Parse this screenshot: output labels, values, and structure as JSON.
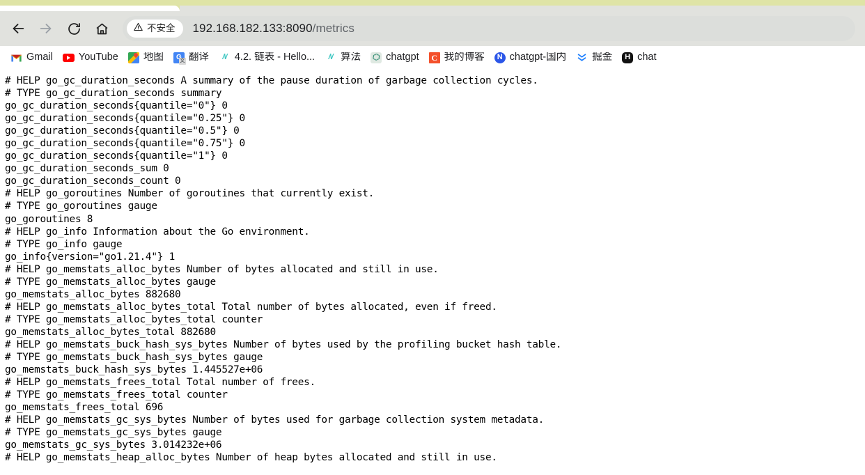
{
  "browser": {
    "tab_strip_color": "#dfe4a6",
    "toolbar_color": "#e1e2de",
    "nav": {
      "back_label": "Back",
      "forward_label": "Forward",
      "reload_label": "Reload",
      "home_label": "Home"
    },
    "omnibox": {
      "security_label": "不安全",
      "url_host": "192.168.182.133:8090",
      "url_path": "/metrics",
      "full_url": "192.168.182.133:8090/metrics"
    },
    "bookmarks": [
      {
        "label": "Gmail",
        "icon": "gmail-icon"
      },
      {
        "label": "YouTube",
        "icon": "youtube-icon"
      },
      {
        "label": "地图",
        "icon": "google-maps-icon"
      },
      {
        "label": "翻译",
        "icon": "google-translate-icon"
      },
      {
        "label": "4.2. 链表 - Hello...",
        "icon": "hello-algo-icon"
      },
      {
        "label": "算法",
        "icon": "hello-algo-icon"
      },
      {
        "label": "chatgpt",
        "icon": "chatgpt-icon"
      },
      {
        "label": "我的博客",
        "icon": "blog-c-icon"
      },
      {
        "label": "chatgpt-国内",
        "icon": "nami-n-icon"
      },
      {
        "label": "掘金",
        "icon": "juejin-icon"
      },
      {
        "label": "chat",
        "icon": "chat-h-icon"
      }
    ]
  },
  "page": {
    "content_type": "prometheus-metrics-plaintext",
    "text": "# HELP go_gc_duration_seconds A summary of the pause duration of garbage collection cycles.\n# TYPE go_gc_duration_seconds summary\ngo_gc_duration_seconds{quantile=\"0\"} 0\ngo_gc_duration_seconds{quantile=\"0.25\"} 0\ngo_gc_duration_seconds{quantile=\"0.5\"} 0\ngo_gc_duration_seconds{quantile=\"0.75\"} 0\ngo_gc_duration_seconds{quantile=\"1\"} 0\ngo_gc_duration_seconds_sum 0\ngo_gc_duration_seconds_count 0\n# HELP go_goroutines Number of goroutines that currently exist.\n# TYPE go_goroutines gauge\ngo_goroutines 8\n# HELP go_info Information about the Go environment.\n# TYPE go_info gauge\ngo_info{version=\"go1.21.4\"} 1\n# HELP go_memstats_alloc_bytes Number of bytes allocated and still in use.\n# TYPE go_memstats_alloc_bytes gauge\ngo_memstats_alloc_bytes 882680\n# HELP go_memstats_alloc_bytes_total Total number of bytes allocated, even if freed.\n# TYPE go_memstats_alloc_bytes_total counter\ngo_memstats_alloc_bytes_total 882680\n# HELP go_memstats_buck_hash_sys_bytes Number of bytes used by the profiling bucket hash table.\n# TYPE go_memstats_buck_hash_sys_bytes gauge\ngo_memstats_buck_hash_sys_bytes 1.445527e+06\n# HELP go_memstats_frees_total Total number of frees.\n# TYPE go_memstats_frees_total counter\ngo_memstats_frees_total 696\n# HELP go_memstats_gc_sys_bytes Number of bytes used for garbage collection system metadata.\n# TYPE go_memstats_gc_sys_bytes gauge\ngo_memstats_gc_sys_bytes 3.014232e+06\n# HELP go_memstats_heap_alloc_bytes Number of heap bytes allocated and still in use."
  }
}
